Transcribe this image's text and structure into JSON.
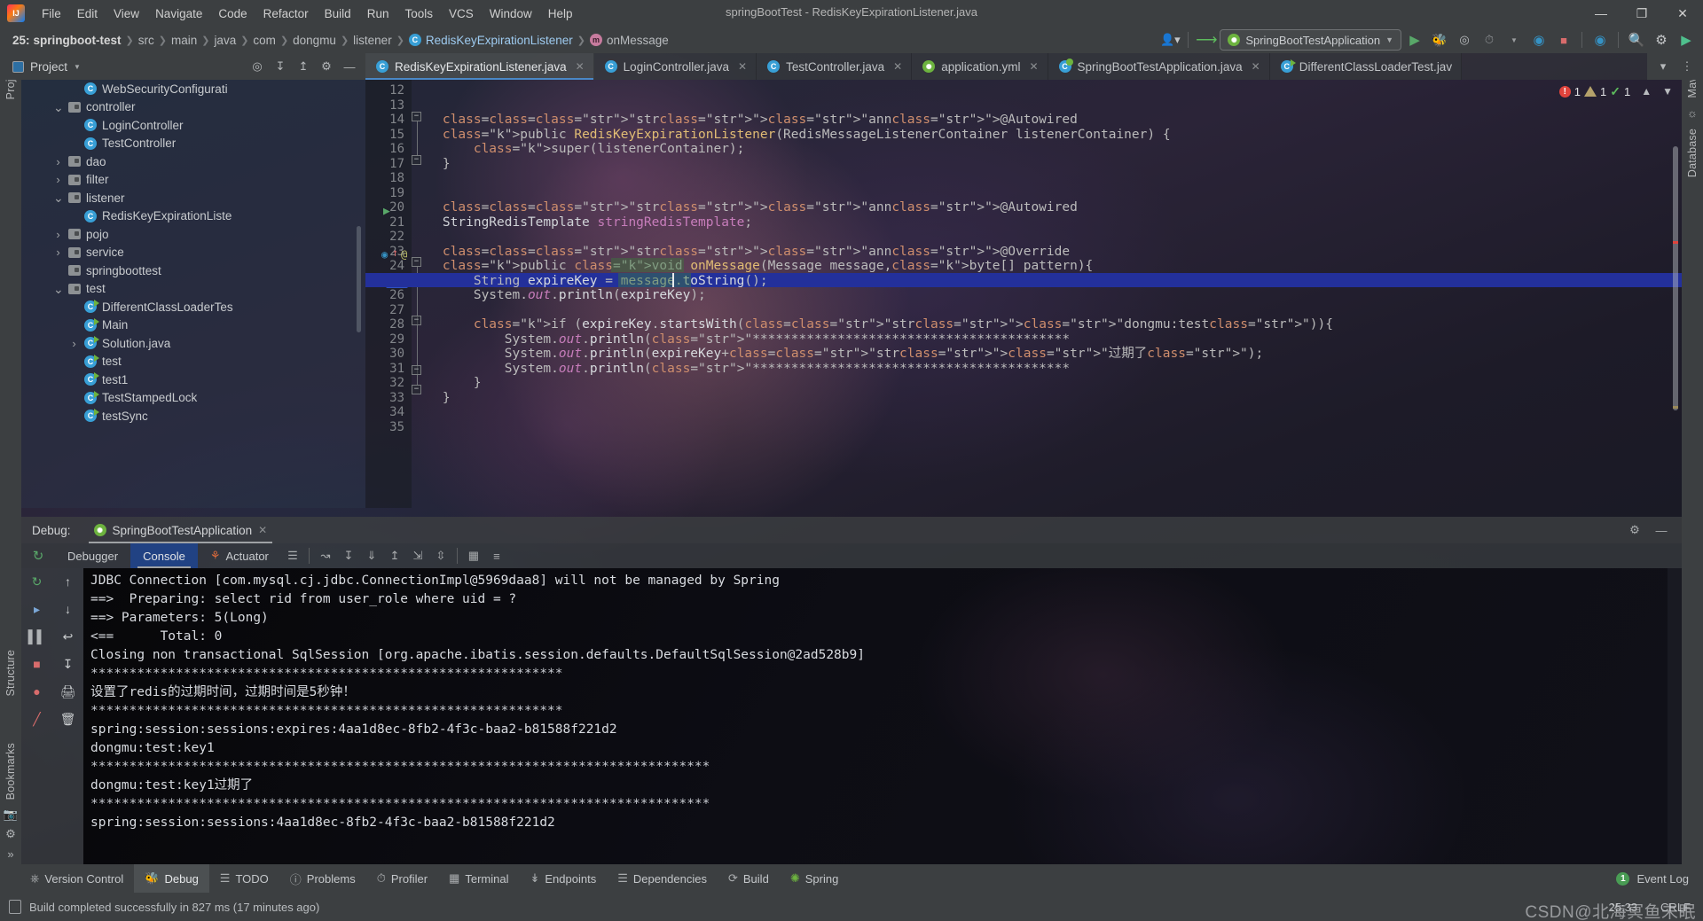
{
  "window": {
    "title": "springBootTest - RedisKeyExpirationListener.java",
    "minimize": "—",
    "maximize": "❐",
    "close": "✕"
  },
  "menu": {
    "items": [
      "File",
      "Edit",
      "View",
      "Navigate",
      "Code",
      "Refactor",
      "Build",
      "Run",
      "Tools",
      "VCS",
      "Window",
      "Help"
    ]
  },
  "breadcrumb": {
    "line_prefix": "25:",
    "items": [
      "springboot-test",
      "src",
      "main",
      "java",
      "com",
      "dongmu",
      "listener",
      "RedisKeyExpirationListener",
      "onMessage"
    ],
    "class_icon": "C",
    "method_icon": "m"
  },
  "nav_toolbar": {
    "run_config": "SpringBootTestApplication",
    "icons": [
      "user-account-icon",
      "updates-icon",
      "run-icon",
      "debug-icon",
      "run-coverage-icon",
      "profiler-icon",
      "profiler-dropdown-icon",
      "stop-icon",
      "search-icon",
      "settings-icon",
      "ide-feature-icon"
    ]
  },
  "project_panel": {
    "title": "Project",
    "tools": [
      "locate-icon",
      "expand-all-icon",
      "collapse-all-icon",
      "settings-icon",
      "hide-icon"
    ],
    "tree": [
      {
        "label": "WebSecurityConfigurati",
        "indent": 5,
        "arrow": "",
        "kind": "class"
      },
      {
        "label": "controller",
        "indent": 4,
        "arrow": "v",
        "kind": "folder"
      },
      {
        "label": "LoginController",
        "indent": 5,
        "arrow": "",
        "kind": "class"
      },
      {
        "label": "TestController",
        "indent": 5,
        "arrow": "",
        "kind": "class"
      },
      {
        "label": "dao",
        "indent": 4,
        "arrow": ">",
        "kind": "folder"
      },
      {
        "label": "filter",
        "indent": 4,
        "arrow": ">",
        "kind": "folder"
      },
      {
        "label": "listener",
        "indent": 4,
        "arrow": "v",
        "kind": "folder"
      },
      {
        "label": "RedisKeyExpirationListe",
        "indent": 5,
        "arrow": "",
        "kind": "class"
      },
      {
        "label": "pojo",
        "indent": 4,
        "arrow": ">",
        "kind": "folder"
      },
      {
        "label": "service",
        "indent": 4,
        "arrow": ">",
        "kind": "folder"
      },
      {
        "label": "springboottest",
        "indent": 4,
        "arrow": "",
        "kind": "folder"
      },
      {
        "label": "test",
        "indent": 4,
        "arrow": "v",
        "kind": "folder"
      },
      {
        "label": "DifferentClassLoaderTes",
        "indent": 5,
        "arrow": "",
        "kind": "runclass"
      },
      {
        "label": "Main",
        "indent": 5,
        "arrow": "",
        "kind": "runclass"
      },
      {
        "label": "Solution.java",
        "indent": 5,
        "arrow": ">",
        "kind": "runclass"
      },
      {
        "label": "test",
        "indent": 5,
        "arrow": "",
        "kind": "runclass"
      },
      {
        "label": "test1",
        "indent": 5,
        "arrow": "",
        "kind": "runclass"
      },
      {
        "label": "TestStampedLock",
        "indent": 5,
        "arrow": "",
        "kind": "runclass"
      },
      {
        "label": "testSync",
        "indent": 5,
        "arrow": "",
        "kind": "runclass"
      }
    ]
  },
  "editor_tabs": [
    {
      "label": "RedisKeyExpirationListener.java",
      "icon": "class-icon",
      "active": true
    },
    {
      "label": "LoginController.java",
      "icon": "class-icon",
      "active": false
    },
    {
      "label": "TestController.java",
      "icon": "class-icon",
      "active": false
    },
    {
      "label": "application.yml",
      "icon": "spring-yaml-icon",
      "active": false
    },
    {
      "label": "SpringBootTestApplication.java",
      "icon": "springboot-class-icon",
      "active": false
    },
    {
      "label": "DifferentClassLoaderTest.jav",
      "icon": "run-class-icon",
      "active": false
    }
  ],
  "editor": {
    "first_line": 12,
    "last_line": 35,
    "current_line": 25,
    "lines": [
      {
        "n": 12,
        "text": ""
      },
      {
        "n": 13,
        "text": ""
      },
      {
        "n": 14,
        "text": "    @Autowired"
      },
      {
        "n": 15,
        "text": "    public RedisKeyExpirationListener(RedisMessageListenerContainer listenerContainer) {"
      },
      {
        "n": 16,
        "text": "        super(listenerContainer);"
      },
      {
        "n": 17,
        "text": "    }"
      },
      {
        "n": 18,
        "text": ""
      },
      {
        "n": 19,
        "text": ""
      },
      {
        "n": 20,
        "text": "    @Autowired"
      },
      {
        "n": 21,
        "text": "    StringRedisTemplate stringRedisTemplate;"
      },
      {
        "n": 22,
        "text": ""
      },
      {
        "n": 23,
        "text": "    @Override"
      },
      {
        "n": 24,
        "text": "    public void onMessage(Message message,byte[] pattern){"
      },
      {
        "n": 25,
        "text": "        String expireKey = message.toString();"
      },
      {
        "n": 26,
        "text": "        System.out.println(expireKey);"
      },
      {
        "n": 27,
        "text": ""
      },
      {
        "n": 28,
        "text": "        if (expireKey.startsWith(\"dongmu:test\")){"
      },
      {
        "n": 29,
        "text": "            System.out.println(\"*****************************************"
      },
      {
        "n": 30,
        "text": "            System.out.println(expireKey+\"过期了\");"
      },
      {
        "n": 31,
        "text": "            System.out.println(\"*****************************************"
      },
      {
        "n": 32,
        "text": "        }"
      },
      {
        "n": 33,
        "text": "    }"
      },
      {
        "n": 34,
        "text": ""
      },
      {
        "n": 35,
        "text": ""
      }
    ],
    "inspections": {
      "errors": "1",
      "warnings": "1",
      "checks": "1"
    }
  },
  "debug_panel": {
    "label": "Debug:",
    "session": "SpringBootTestApplication",
    "close": "✕",
    "tabs": [
      "Debugger",
      "Console",
      "Actuator"
    ],
    "active_tab": "Console",
    "stepping_icons": [
      "step-over-icon",
      "step-into-icon",
      "force-step-into-icon",
      "step-out-icon",
      "run-to-cursor-icon",
      "drop-frame-icon",
      "evaluate-icon",
      "settings-icon"
    ],
    "side_icons": [
      "rerun-icon",
      "up-icon",
      "down-icon",
      "resume-icon",
      "mute-breakpoints-icon",
      "pause-icon",
      "layout-icon",
      "stop-icon",
      "breakpoints-icon",
      "print-icon",
      "restore-icon",
      "trash-icon"
    ],
    "console_lines": [
      "JDBC Connection [com.mysql.cj.jdbc.ConnectionImpl@5969daa8] will not be managed by Spring",
      "==>  Preparing: select rid from user_role where uid = ?",
      "==> Parameters: 5(Long)",
      "<==      Total: 0",
      "Closing non transactional SqlSession [org.apache.ibatis.session.defaults.DefaultSqlSession@2ad528b9]",
      "*************************************************************",
      "设置了redis的过期时间，过期时间是5秒钟！",
      "*************************************************************",
      "spring:session:sessions:expires:4aa1d8ec-8fb2-4f3c-baa2-b81588f221d2",
      "dongmu:test:key1",
      "********************************************************************************",
      "dongmu:test:key1过期了",
      "********************************************************************************",
      "spring:session:sessions:4aa1d8ec-8fb2-4f3c-baa2-b81588f221d2"
    ]
  },
  "tool_window_bar": {
    "items": [
      {
        "label": "Version Control",
        "icon": "branch-icon",
        "active": false
      },
      {
        "label": "Debug",
        "icon": "debug-icon",
        "active": true
      },
      {
        "label": "TODO",
        "icon": "todo-icon",
        "active": false
      },
      {
        "label": "Problems",
        "icon": "problems-icon",
        "active": false
      },
      {
        "label": "Profiler",
        "icon": "profiler-icon",
        "active": false
      },
      {
        "label": "Terminal",
        "icon": "terminal-icon",
        "active": false
      },
      {
        "label": "Endpoints",
        "icon": "endpoints-icon",
        "active": false
      },
      {
        "label": "Dependencies",
        "icon": "dependencies-icon",
        "active": false
      },
      {
        "label": "Build",
        "icon": "build-icon",
        "active": false
      },
      {
        "label": "Spring",
        "icon": "spring-icon",
        "active": false
      }
    ],
    "event_log": "Event Log",
    "event_count": "1"
  },
  "status_bar": {
    "message": "Build completed successfully in 827 ms (17 minutes ago)",
    "caret_position": "25:33",
    "line_separator": "CRLF",
    "watermark": "CSDN@北海冥鱼未眠"
  },
  "left_strip": {
    "labels": [
      "Project",
      "Structure",
      "Bookmarks"
    ],
    "icons": [
      "commit-icon",
      "camera-icon",
      "settings-icon",
      "more-icon"
    ]
  },
  "right_strip": {
    "labels": [
      "Maven",
      "Database"
    ],
    "icons": [
      "database-icon"
    ]
  },
  "colors": {
    "accent": "#4a88c7",
    "error": "#e0433c",
    "warning": "#b5a26b",
    "success": "#499c54",
    "selection": "#23309b",
    "panel": "#3c3f41"
  }
}
